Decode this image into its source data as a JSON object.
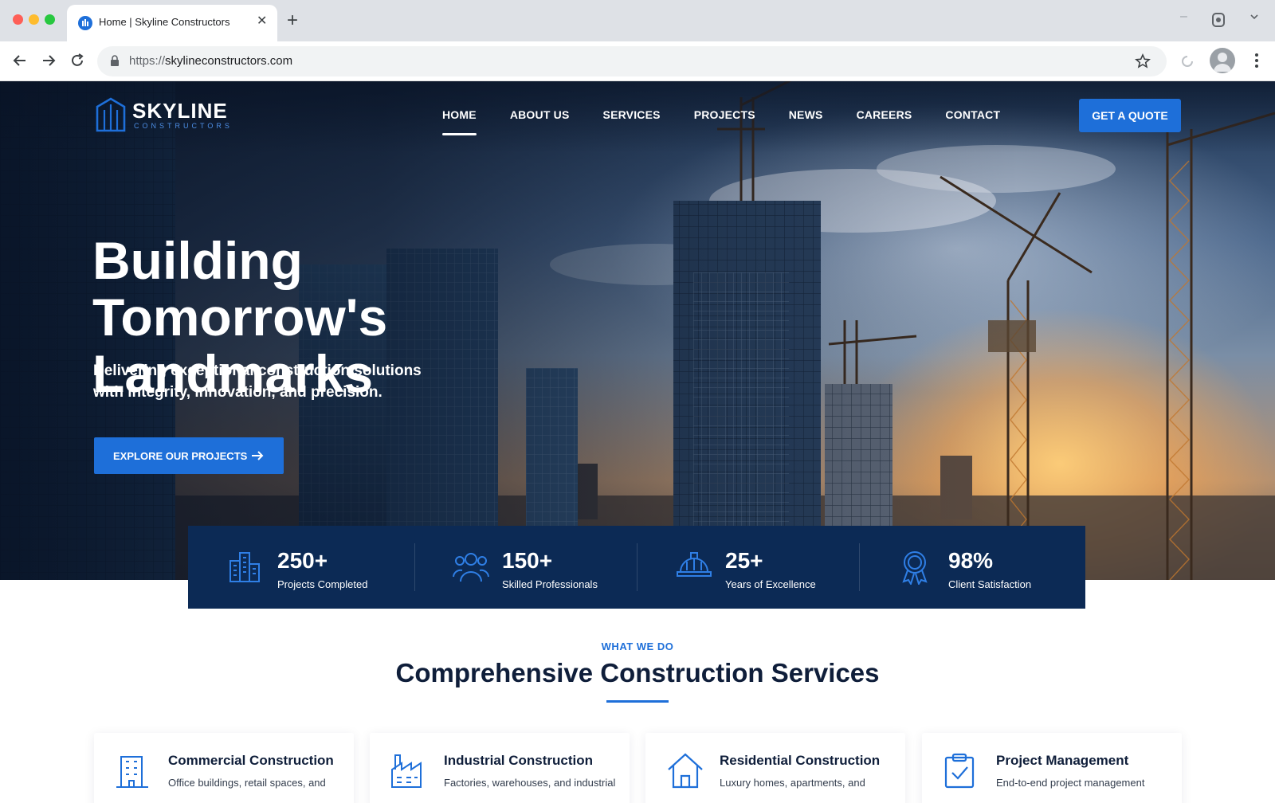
{
  "browser": {
    "tab_title": "Home | Skyline Constructors",
    "url_scheme": "https://",
    "url_host": "skylineconstructors.com",
    "icons": [
      "back-icon",
      "forward-icon",
      "reload-icon",
      "lock-icon",
      "star-icon",
      "close-icon",
      "plus-icon",
      "profile-icon",
      "menu-icon"
    ]
  },
  "site": {
    "logo_name": "SKYLINE",
    "logo_sub": "CONSTRUCTORS",
    "nav": [
      "HOME",
      "ABOUT US",
      "SERVICES",
      "PROJECTS",
      "NEWS",
      "CAREERS",
      "CONTACT"
    ],
    "active_nav": "HOME",
    "quote_button": "GET A QUOTE",
    "accent_color": "#1e6fd9",
    "navy_color": "#0c2a55"
  },
  "hero": {
    "headline_line1": "Building",
    "headline_line2": "Tomorrow's Landmarks",
    "subhead_line1": "Delivering exceptional construction solutions",
    "subhead_line2": "with integrity, innovation, and precision.",
    "cta_label": "EXPLORE OUR PROJECTS"
  },
  "stats": [
    {
      "value": "250+",
      "label": "Projects Completed",
      "icon": "buildings-icon"
    },
    {
      "value": "150+",
      "label": "Skilled Professionals",
      "icon": "team-icon"
    },
    {
      "value": "25+",
      "label": "Years of Excellence",
      "icon": "hard-hat-icon"
    },
    {
      "value": "98%",
      "label": "Client Satisfaction",
      "icon": "award-icon"
    }
  ],
  "services": {
    "eyebrow": "WHAT WE DO",
    "title": "Comprehensive Construction Services",
    "cards": [
      {
        "title": "Commercial Construction",
        "desc": "Office buildings, retail spaces, and",
        "icon": "office-building-icon"
      },
      {
        "title": "Industrial Construction",
        "desc": "Factories, warehouses, and industrial",
        "icon": "factory-icon"
      },
      {
        "title": "Residential Construction",
        "desc": "Luxury homes, apartments, and",
        "icon": "house-icon"
      },
      {
        "title": "Project Management",
        "desc": "End-to-end project management",
        "icon": "clipboard-check-icon"
      }
    ]
  }
}
